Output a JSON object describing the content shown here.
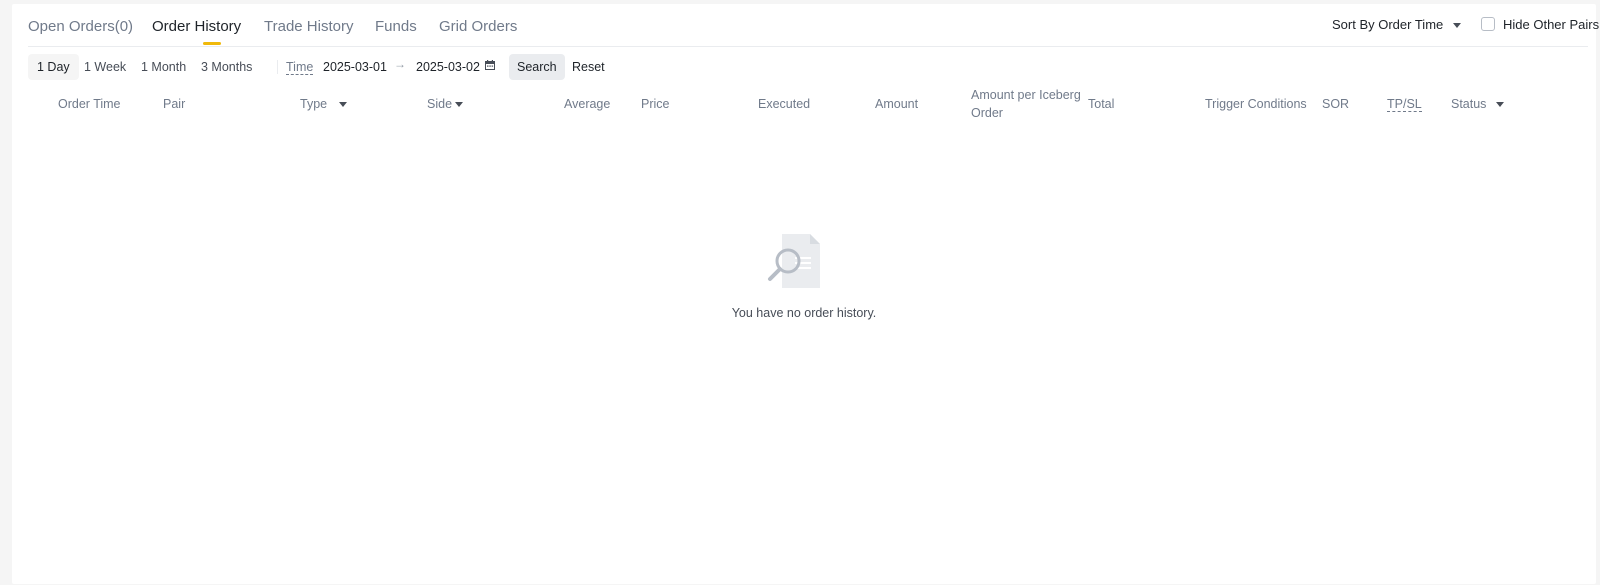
{
  "tabs": [
    {
      "label": "Open Orders(0)"
    },
    {
      "label": "Order History"
    },
    {
      "label": "Trade History"
    },
    {
      "label": "Funds"
    },
    {
      "label": "Grid Orders"
    }
  ],
  "active_tab": "Order History",
  "sort": {
    "label": "Sort By Order Time"
  },
  "hide_other_pairs": {
    "label": "Hide Other Pairs",
    "checked": false
  },
  "filters": {
    "ranges": [
      {
        "label": "1 Day"
      },
      {
        "label": "1 Week"
      },
      {
        "label": "1 Month"
      },
      {
        "label": "3 Months"
      }
    ],
    "active_range": "1 Day",
    "time_label": "Time",
    "start_date": "2025-03-01",
    "end_date": "2025-03-02",
    "search_label": "Search",
    "reset_label": "Reset"
  },
  "columns": [
    {
      "label": "Order Time"
    },
    {
      "label": "Pair"
    },
    {
      "label": "Type"
    },
    {
      "label": "Side"
    },
    {
      "label": "Average"
    },
    {
      "label": "Price"
    },
    {
      "label": "Executed"
    },
    {
      "label": "Amount"
    },
    {
      "label": "Amount per Iceberg Order"
    },
    {
      "label": "Total"
    },
    {
      "label": "Trigger Conditions"
    },
    {
      "label": "SOR"
    },
    {
      "label": "TP/SL"
    },
    {
      "label": "Status"
    }
  ],
  "empty": {
    "message": "You have no order history."
  },
  "colors": {
    "accent": "#f0b90b",
    "text_primary": "#1e2329",
    "text_secondary": "#707a8a"
  }
}
